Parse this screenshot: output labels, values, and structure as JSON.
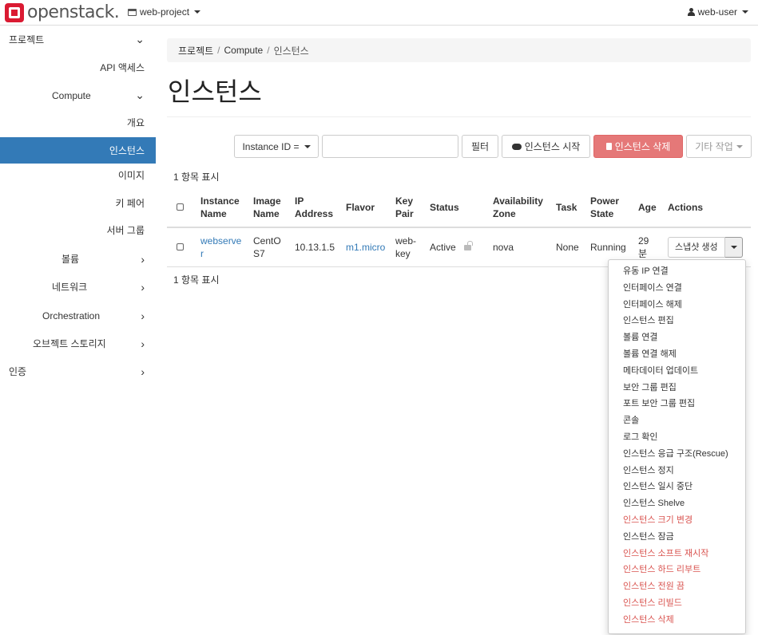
{
  "topbar": {
    "logo_text": "openstack.",
    "project": "web-project",
    "user": "web-user"
  },
  "sidebar": {
    "items": [
      {
        "label": "프로젝트",
        "chevron": "down"
      },
      {
        "label": "API 액세스"
      },
      {
        "label": "Compute",
        "chevron": "down"
      },
      {
        "label": "개요"
      },
      {
        "label": "인스턴스",
        "active": true
      },
      {
        "label": "이미지"
      },
      {
        "label": "키 페어"
      },
      {
        "label": "서버 그룹"
      },
      {
        "label": "볼륨",
        "chevron": "right"
      },
      {
        "label": "네트워크",
        "chevron": "right"
      },
      {
        "label": "Orchestration",
        "chevron": "right"
      },
      {
        "label": "오브젝트 스토리지",
        "chevron": "right"
      },
      {
        "label": "인증",
        "chevron": "right"
      }
    ]
  },
  "breadcrumb": [
    "프로젝트",
    "Compute",
    "인스턴스"
  ],
  "page_title": "인스턴스",
  "toolbar": {
    "filter_select": "Instance ID =",
    "search_value": "",
    "filter_button": "필터",
    "launch_button": "인스턴스 시작",
    "delete_button": "인스턴스 삭제",
    "more_button": "기타 작업"
  },
  "count_text": "1 항목 표시",
  "table": {
    "headers": [
      "Instance Name",
      "Image Name",
      "IP Address",
      "Flavor",
      "Key Pair",
      "Status",
      "Availability Zone",
      "Task",
      "Power State",
      "Age",
      "Actions"
    ],
    "rows": [
      {
        "instance_name": "webserver",
        "image_name": "CentOS7",
        "ip": "10.13.1.5",
        "flavor": "m1.micro",
        "key_pair": "web-key",
        "status": "Active",
        "zone": "nova",
        "task": "None",
        "power_state": "Running",
        "age": "29 분",
        "action": "스냅샷 생성"
      }
    ]
  },
  "dropdown_items": [
    {
      "label": "유동 IP 연결"
    },
    {
      "label": "인터페이스 연결"
    },
    {
      "label": "인터페이스 해제"
    },
    {
      "label": "인스턴스 편집"
    },
    {
      "label": "볼륨 연결"
    },
    {
      "label": "볼륨 연결 해제"
    },
    {
      "label": "메타데이터 업데이트"
    },
    {
      "label": "보안 그룹 편집"
    },
    {
      "label": "포트 보안 그룹 편집"
    },
    {
      "label": "콘솔"
    },
    {
      "label": "로그 확인"
    },
    {
      "label": "인스턴스 응급 구조(Rescue)"
    },
    {
      "label": "인스턴스 정지"
    },
    {
      "label": "인스턴스 일시 중단"
    },
    {
      "label": "인스턴스 Shelve"
    },
    {
      "label": "인스턴스 크기 변경",
      "danger": true
    },
    {
      "label": "인스턴스 잠금"
    },
    {
      "label": "인스턴스 소프트 재시작",
      "danger": true
    },
    {
      "label": "인스턴스 하드 리부트",
      "danger": true
    },
    {
      "label": "인스턴스 전원 끔",
      "danger": true
    },
    {
      "label": "인스턴스 리빌드",
      "danger": true
    },
    {
      "label": "인스턴스 삭제",
      "danger": true
    }
  ],
  "colors": {
    "active_nav": "#337ab7",
    "danger": "#d9534f",
    "danger_button": "#e57878",
    "link": "#337ab7"
  }
}
